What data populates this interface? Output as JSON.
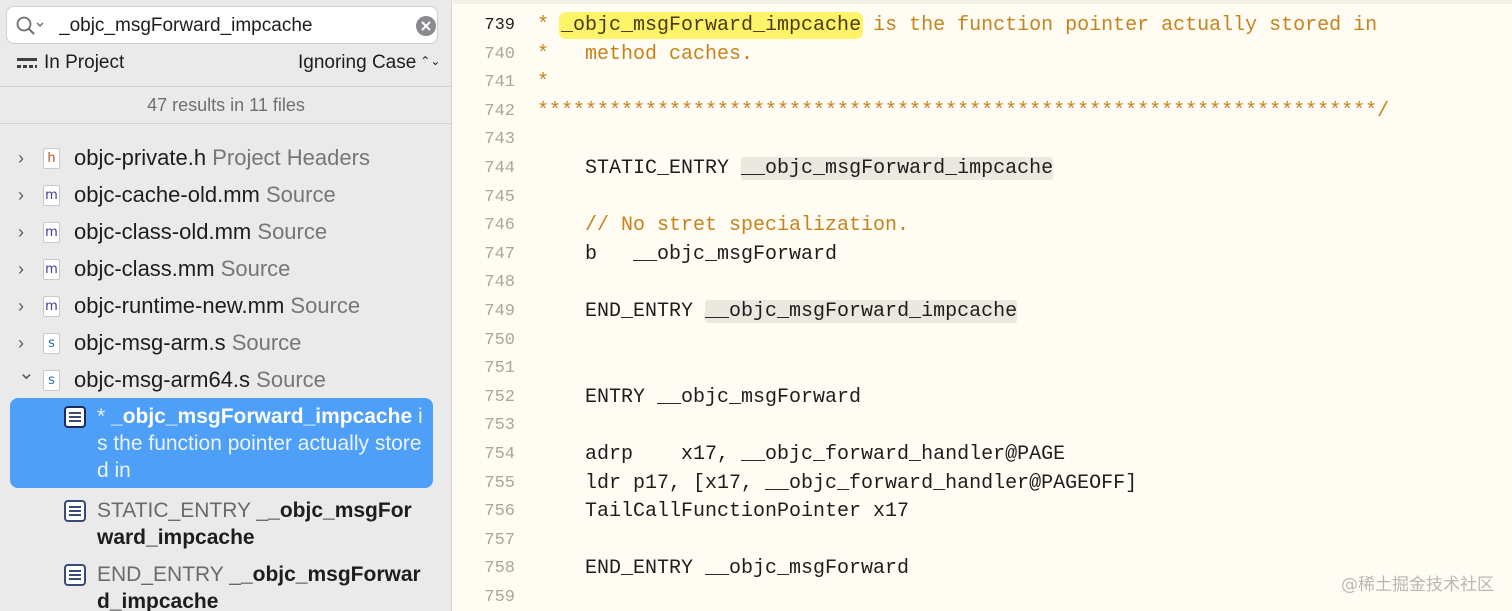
{
  "search": {
    "query": "_objc_msgForward_impcache",
    "scope_label": "In Project",
    "case_option": "Ignoring Case",
    "results_summary": "47 results in 11 files"
  },
  "files": [
    {
      "icon_letter": "h",
      "icon_color": "#b0532a",
      "name": "objc-private.h",
      "group": "Project Headers",
      "expanded": false
    },
    {
      "icon_letter": "m",
      "icon_color": "#3a3aa0",
      "name": "objc-cache-old.mm",
      "group": "Source",
      "expanded": false
    },
    {
      "icon_letter": "m",
      "icon_color": "#3a3aa0",
      "name": "objc-class-old.mm",
      "group": "Source",
      "expanded": false
    },
    {
      "icon_letter": "m",
      "icon_color": "#3a3aa0",
      "name": "objc-class.mm",
      "group": "Source",
      "expanded": false
    },
    {
      "icon_letter": "m",
      "icon_color": "#3a3aa0",
      "name": "objc-runtime-new.mm",
      "group": "Source",
      "expanded": false
    },
    {
      "icon_letter": "s",
      "icon_color": "#2c6aa8",
      "name": "objc-msg-arm.s",
      "group": "Source",
      "expanded": false
    },
    {
      "icon_letter": "s",
      "icon_color": "#2c6aa8",
      "name": "objc-msg-arm64.s",
      "group": "Source",
      "expanded": true
    }
  ],
  "matches": [
    {
      "prefix": "* ",
      "match": "_objc_msgForward_impcache",
      "suffix": " is the function pointer actually stored in",
      "selected": true
    },
    {
      "prefix": "STATIC_ENTRY _",
      "match": "_objc_msgForward_impcache",
      "suffix": "",
      "selected": false
    },
    {
      "prefix": "END_ENTRY _",
      "match": "_objc_msgForward_impcache",
      "suffix": "",
      "selected": false
    }
  ],
  "editor": {
    "current_line": 739,
    "lines": [
      {
        "num": 739,
        "type": "comment",
        "parts": [
          {
            "t": "* "
          },
          {
            "t": "_objc_msgForward_impcache",
            "hl": "yellow"
          },
          {
            "t": " is the function pointer actually stored in"
          }
        ]
      },
      {
        "num": 740,
        "type": "comment",
        "parts": [
          {
            "t": "*   method caches."
          }
        ]
      },
      {
        "num": 741,
        "type": "comment",
        "parts": [
          {
            "t": "*"
          }
        ]
      },
      {
        "num": 742,
        "type": "comment",
        "parts": [
          {
            "t": "**********************************************************************/"
          }
        ]
      },
      {
        "num": 743,
        "type": "code",
        "parts": []
      },
      {
        "num": 744,
        "type": "code",
        "parts": [
          {
            "t": "    STATIC_ENTRY "
          },
          {
            "t": "__objc_msgForward_impcache",
            "hl": "grey"
          }
        ]
      },
      {
        "num": 745,
        "type": "code",
        "parts": []
      },
      {
        "num": 746,
        "type": "comment",
        "parts": [
          {
            "t": "    // No stret specialization."
          }
        ]
      },
      {
        "num": 747,
        "type": "code",
        "parts": [
          {
            "t": "    b   __objc_msgForward"
          }
        ]
      },
      {
        "num": 748,
        "type": "code",
        "parts": []
      },
      {
        "num": 749,
        "type": "code",
        "parts": [
          {
            "t": "    END_ENTRY "
          },
          {
            "t": "__objc_msgForward_impcache",
            "hl": "grey"
          }
        ]
      },
      {
        "num": 750,
        "type": "code",
        "parts": []
      },
      {
        "num": 751,
        "type": "code",
        "parts": []
      },
      {
        "num": 752,
        "type": "code",
        "parts": [
          {
            "t": "    ENTRY __objc_msgForward"
          }
        ]
      },
      {
        "num": 753,
        "type": "code",
        "parts": []
      },
      {
        "num": 754,
        "type": "code",
        "parts": [
          {
            "t": "    adrp    x17, __objc_forward_handler@PAGE"
          }
        ]
      },
      {
        "num": 755,
        "type": "code",
        "parts": [
          {
            "t": "    ldr p17, [x17, __objc_forward_handler@PAGEOFF]"
          }
        ]
      },
      {
        "num": 756,
        "type": "code",
        "parts": [
          {
            "t": "    TailCallFunctionPointer x17"
          }
        ]
      },
      {
        "num": 757,
        "type": "code",
        "parts": []
      },
      {
        "num": 758,
        "type": "code",
        "parts": [
          {
            "t": "    END_ENTRY __objc_msgForward"
          }
        ]
      },
      {
        "num": 759,
        "type": "code",
        "parts": []
      }
    ]
  },
  "watermark": "@稀土掘金技术社区",
  "colors": {
    "selection": "#4d9ff7",
    "comment": "#c7821c",
    "highlight": "#fff36a",
    "editor_bg": "#fffdf3"
  }
}
